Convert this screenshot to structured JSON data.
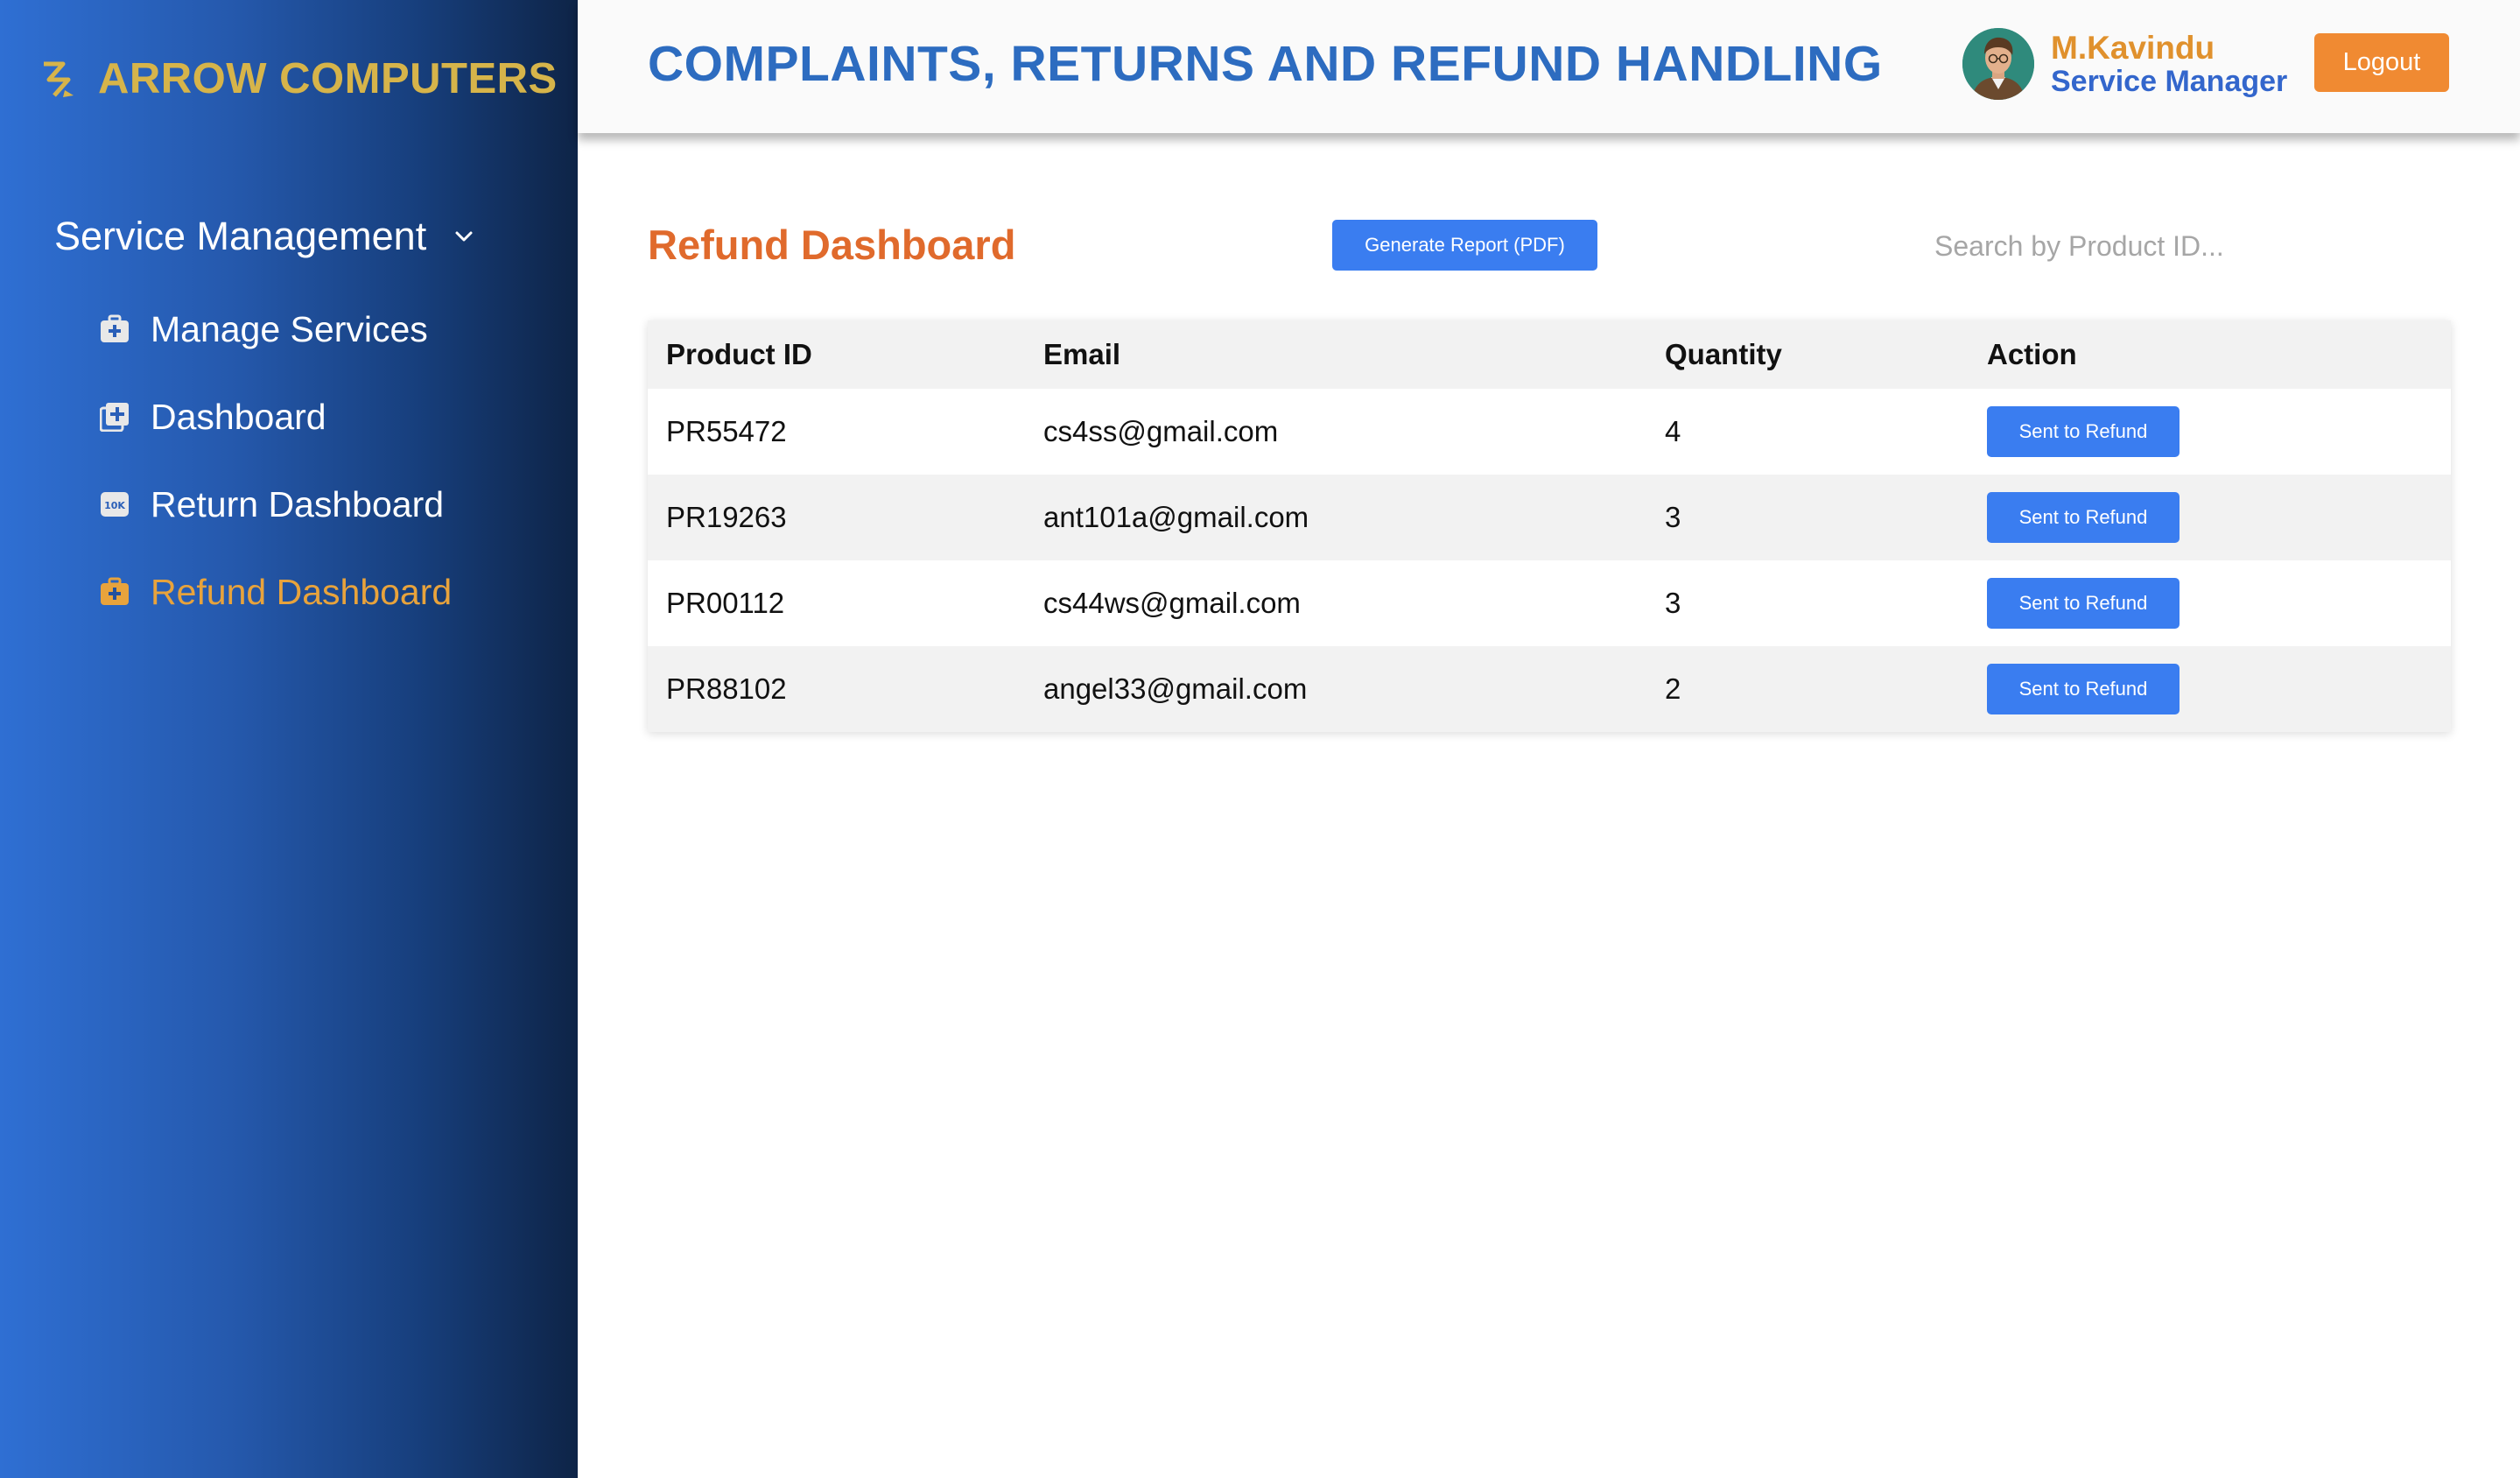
{
  "brand": {
    "name": "ARROW COMPUTERS",
    "icon": "arrow-logo-icon",
    "color": "#d6b44a"
  },
  "sidebar": {
    "group_label": "Service Management",
    "items": [
      {
        "label": "Manage Services",
        "icon": "medkit-icon",
        "active": false
      },
      {
        "label": "Dashboard",
        "icon": "add-square-icon",
        "active": false
      },
      {
        "label": "Return Dashboard",
        "icon": "10k-icon",
        "active": false
      },
      {
        "label": "Refund Dashboard",
        "icon": "medkit-icon",
        "active": true
      }
    ]
  },
  "header": {
    "title": "COMPLAINTS, RETURNS AND REFUND HANDLING",
    "user_name": "M.Kavindu",
    "user_role": "Service Manager",
    "logout_label": "Logout"
  },
  "main": {
    "section_title": "Refund Dashboard",
    "report_button_label": "Generate Report (PDF)",
    "search_placeholder": "Search by Product ID...",
    "columns": [
      "Product ID",
      "Email",
      "Quantity",
      "Action"
    ],
    "rows": [
      {
        "product_id": "PR55472",
        "email": "cs4ss@gmail.com",
        "quantity": "4",
        "action": "Sent to Refund"
      },
      {
        "product_id": "PR19263",
        "email": "ant101a@gmail.com",
        "quantity": "3",
        "action": "Sent to Refund"
      },
      {
        "product_id": "PR00112",
        "email": "cs44ws@gmail.com",
        "quantity": "3",
        "action": "Sent to Refund"
      },
      {
        "product_id": "PR88102",
        "email": "angel33@gmail.com",
        "quantity": "2",
        "action": "Sent to Refund"
      }
    ]
  },
  "colors": {
    "accent_blue": "#3a7df0",
    "title_blue": "#2d6cc0",
    "orange": "#f08a32",
    "section_orange": "#e06a2c",
    "active_nav": "#e8a33c"
  }
}
